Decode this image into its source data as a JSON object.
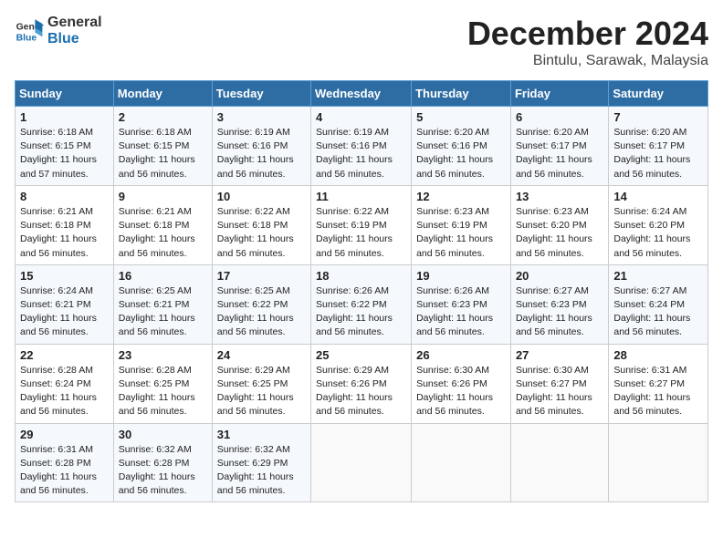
{
  "header": {
    "logo_line1": "General",
    "logo_line2": "Blue",
    "month": "December 2024",
    "location": "Bintulu, Sarawak, Malaysia"
  },
  "weekdays": [
    "Sunday",
    "Monday",
    "Tuesday",
    "Wednesday",
    "Thursday",
    "Friday",
    "Saturday"
  ],
  "weeks": [
    [
      {
        "day": "1",
        "sunrise": "6:18 AM",
        "sunset": "6:15 PM",
        "daylight": "11 hours and 57 minutes."
      },
      {
        "day": "2",
        "sunrise": "6:18 AM",
        "sunset": "6:15 PM",
        "daylight": "11 hours and 56 minutes."
      },
      {
        "day": "3",
        "sunrise": "6:19 AM",
        "sunset": "6:16 PM",
        "daylight": "11 hours and 56 minutes."
      },
      {
        "day": "4",
        "sunrise": "6:19 AM",
        "sunset": "6:16 PM",
        "daylight": "11 hours and 56 minutes."
      },
      {
        "day": "5",
        "sunrise": "6:20 AM",
        "sunset": "6:16 PM",
        "daylight": "11 hours and 56 minutes."
      },
      {
        "day": "6",
        "sunrise": "6:20 AM",
        "sunset": "6:17 PM",
        "daylight": "11 hours and 56 minutes."
      },
      {
        "day": "7",
        "sunrise": "6:20 AM",
        "sunset": "6:17 PM",
        "daylight": "11 hours and 56 minutes."
      }
    ],
    [
      {
        "day": "8",
        "sunrise": "6:21 AM",
        "sunset": "6:18 PM",
        "daylight": "11 hours and 56 minutes."
      },
      {
        "day": "9",
        "sunrise": "6:21 AM",
        "sunset": "6:18 PM",
        "daylight": "11 hours and 56 minutes."
      },
      {
        "day": "10",
        "sunrise": "6:22 AM",
        "sunset": "6:18 PM",
        "daylight": "11 hours and 56 minutes."
      },
      {
        "day": "11",
        "sunrise": "6:22 AM",
        "sunset": "6:19 PM",
        "daylight": "11 hours and 56 minutes."
      },
      {
        "day": "12",
        "sunrise": "6:23 AM",
        "sunset": "6:19 PM",
        "daylight": "11 hours and 56 minutes."
      },
      {
        "day": "13",
        "sunrise": "6:23 AM",
        "sunset": "6:20 PM",
        "daylight": "11 hours and 56 minutes."
      },
      {
        "day": "14",
        "sunrise": "6:24 AM",
        "sunset": "6:20 PM",
        "daylight": "11 hours and 56 minutes."
      }
    ],
    [
      {
        "day": "15",
        "sunrise": "6:24 AM",
        "sunset": "6:21 PM",
        "daylight": "11 hours and 56 minutes."
      },
      {
        "day": "16",
        "sunrise": "6:25 AM",
        "sunset": "6:21 PM",
        "daylight": "11 hours and 56 minutes."
      },
      {
        "day": "17",
        "sunrise": "6:25 AM",
        "sunset": "6:22 PM",
        "daylight": "11 hours and 56 minutes."
      },
      {
        "day": "18",
        "sunrise": "6:26 AM",
        "sunset": "6:22 PM",
        "daylight": "11 hours and 56 minutes."
      },
      {
        "day": "19",
        "sunrise": "6:26 AM",
        "sunset": "6:23 PM",
        "daylight": "11 hours and 56 minutes."
      },
      {
        "day": "20",
        "sunrise": "6:27 AM",
        "sunset": "6:23 PM",
        "daylight": "11 hours and 56 minutes."
      },
      {
        "day": "21",
        "sunrise": "6:27 AM",
        "sunset": "6:24 PM",
        "daylight": "11 hours and 56 minutes."
      }
    ],
    [
      {
        "day": "22",
        "sunrise": "6:28 AM",
        "sunset": "6:24 PM",
        "daylight": "11 hours and 56 minutes."
      },
      {
        "day": "23",
        "sunrise": "6:28 AM",
        "sunset": "6:25 PM",
        "daylight": "11 hours and 56 minutes."
      },
      {
        "day": "24",
        "sunrise": "6:29 AM",
        "sunset": "6:25 PM",
        "daylight": "11 hours and 56 minutes."
      },
      {
        "day": "25",
        "sunrise": "6:29 AM",
        "sunset": "6:26 PM",
        "daylight": "11 hours and 56 minutes."
      },
      {
        "day": "26",
        "sunrise": "6:30 AM",
        "sunset": "6:26 PM",
        "daylight": "11 hours and 56 minutes."
      },
      {
        "day": "27",
        "sunrise": "6:30 AM",
        "sunset": "6:27 PM",
        "daylight": "11 hours and 56 minutes."
      },
      {
        "day": "28",
        "sunrise": "6:31 AM",
        "sunset": "6:27 PM",
        "daylight": "11 hours and 56 minutes."
      }
    ],
    [
      {
        "day": "29",
        "sunrise": "6:31 AM",
        "sunset": "6:28 PM",
        "daylight": "11 hours and 56 minutes."
      },
      {
        "day": "30",
        "sunrise": "6:32 AM",
        "sunset": "6:28 PM",
        "daylight": "11 hours and 56 minutes."
      },
      {
        "day": "31",
        "sunrise": "6:32 AM",
        "sunset": "6:29 PM",
        "daylight": "11 hours and 56 minutes."
      },
      null,
      null,
      null,
      null
    ]
  ]
}
